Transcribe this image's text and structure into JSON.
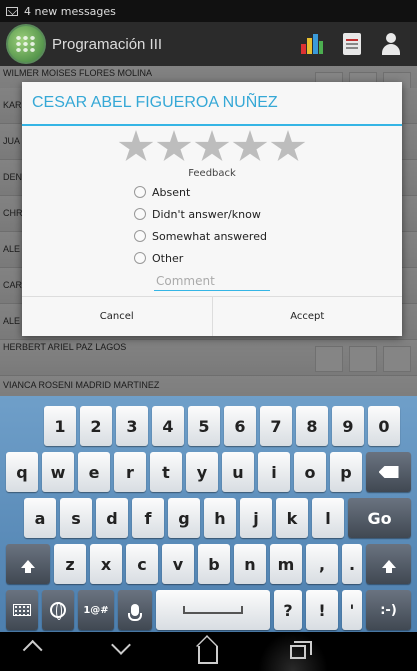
{
  "status_bar": {
    "notification": "4 new messages"
  },
  "action_bar": {
    "title": "Programación III"
  },
  "student_list": [
    "WILMER MOISES FLORES MOLINA",
    "KAR",
    "JUA",
    "DEN",
    "CHR",
    "ALE",
    "CAR",
    "ALE",
    "HERBERT ARIEL PAZ LAGOS",
    "VIANCA ROSENI MADRID MARTINEZ"
  ],
  "dialog": {
    "title": "CESAR ABEL FIGUEROA NUÑEZ",
    "rating": {
      "max": 5,
      "value": 0
    },
    "feedback_label": "Feedback",
    "options": [
      "Absent",
      "Didn't answer/know",
      "Somewhat answered",
      "Other"
    ],
    "comment_placeholder": "Comment",
    "cancel_label": "Cancel",
    "accept_label": "Accept"
  },
  "keyboard": {
    "row1": [
      "1",
      "2",
      "3",
      "4",
      "5",
      "6",
      "7",
      "8",
      "9",
      "0"
    ],
    "row2": [
      "q",
      "w",
      "e",
      "r",
      "t",
      "y",
      "u",
      "i",
      "o",
      "p"
    ],
    "row3": [
      "a",
      "s",
      "d",
      "f",
      "g",
      "h",
      "j",
      "k",
      "l"
    ],
    "row3_action": "Go",
    "row4": [
      "z",
      "x",
      "c",
      "v",
      "b",
      "n",
      "m",
      ",",
      "."
    ],
    "row5": {
      "symbols": "1@#",
      "question": "?",
      "exclaim": "!",
      "apostrophe": "'",
      "smiley": ":-)"
    }
  }
}
